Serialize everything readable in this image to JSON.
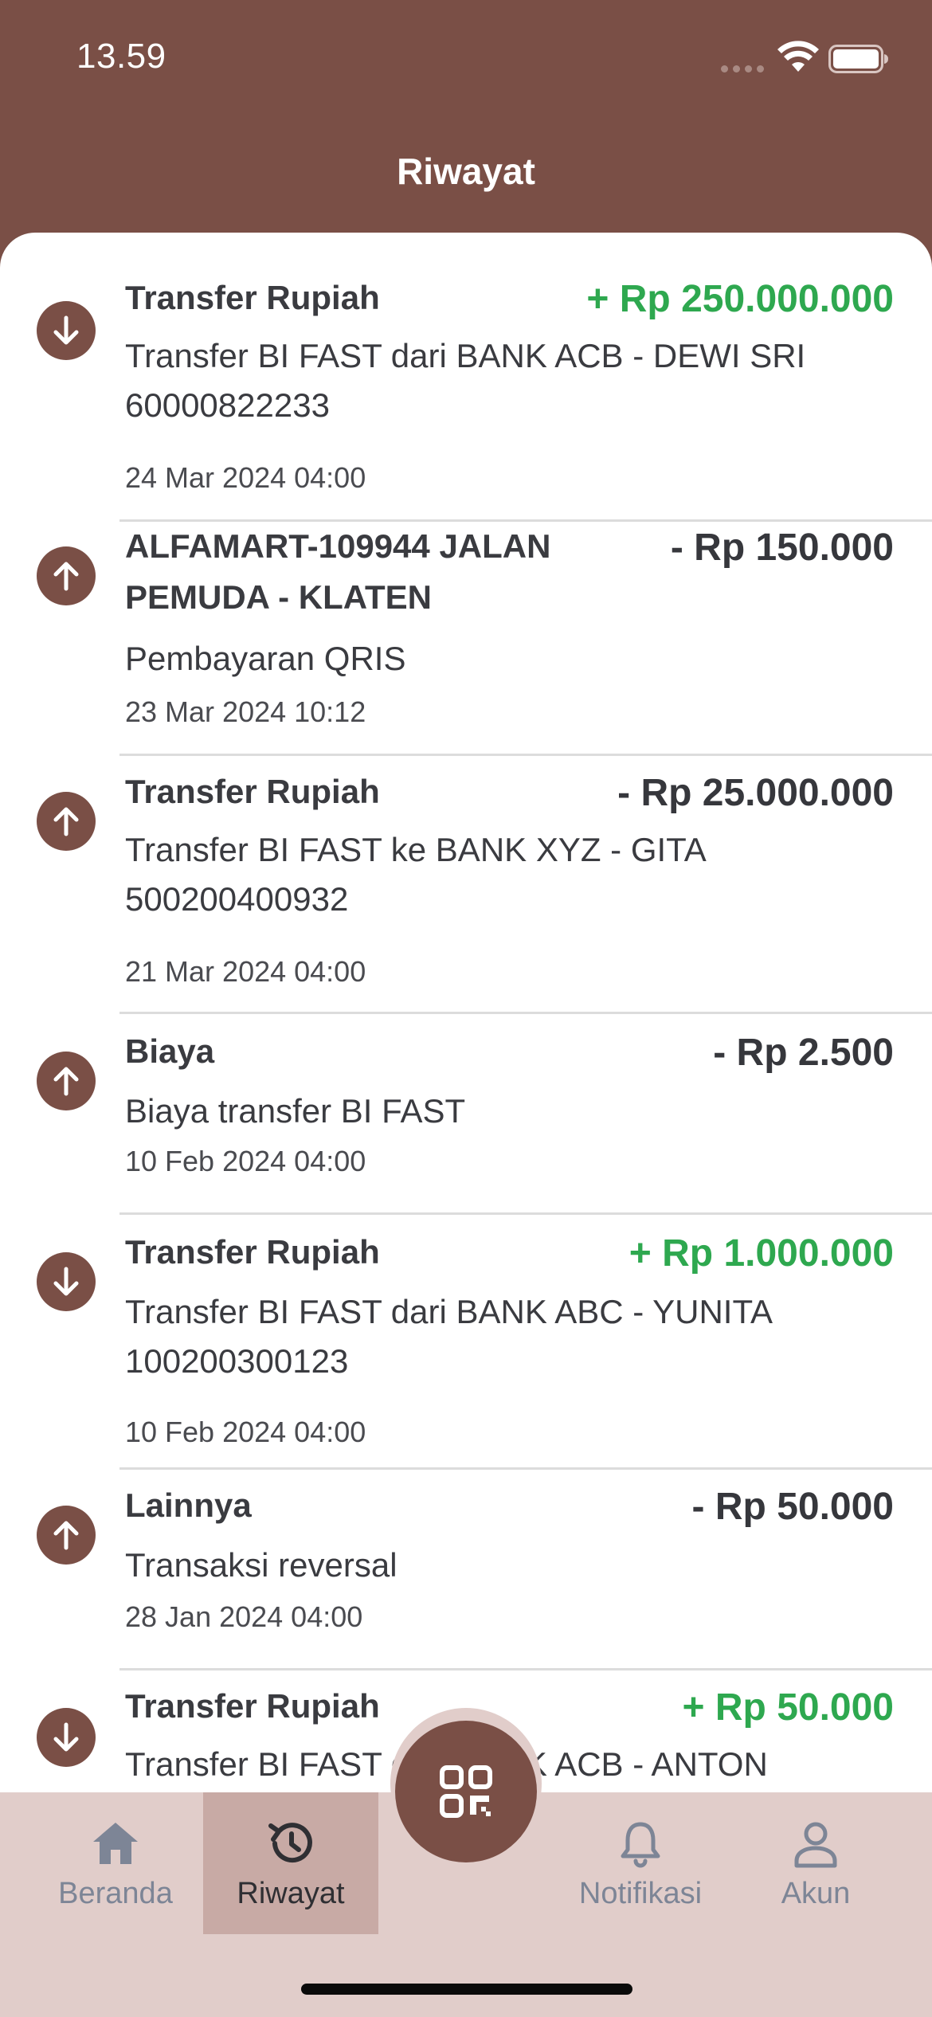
{
  "status_bar": {
    "time": "13.59"
  },
  "header": {
    "title": "Riwayat"
  },
  "transactions": [
    {
      "direction": "in",
      "title": "Transfer Rupiah",
      "amount": "+ Rp 250.000.000",
      "description": "Transfer BI FAST dari BANK ACB - DEWI SRI 60000822233",
      "date": "24 Mar 2024 04:00"
    },
    {
      "direction": "out",
      "title": "ALFAMART-109944 JALAN PEMUDA - KLATEN",
      "amount": "- Rp 150.000",
      "description": "Pembayaran QRIS",
      "date": "23 Mar 2024 10:12"
    },
    {
      "direction": "out",
      "title": "Transfer Rupiah",
      "amount": "- Rp 25.000.000",
      "description": "Transfer BI FAST ke BANK XYZ - GITA 500200400932",
      "date": "21 Mar 2024 04:00"
    },
    {
      "direction": "out",
      "title": "Biaya",
      "amount": "- Rp 2.500",
      "description": "Biaya transfer BI FAST",
      "date": "10 Feb 2024 04:00"
    },
    {
      "direction": "in",
      "title": "Transfer Rupiah",
      "amount": "+ Rp 1.000.000",
      "description": "Transfer BI FAST dari BANK ABC - YUNITA 100200300123",
      "date": "10 Feb 2024 04:00"
    },
    {
      "direction": "out",
      "title": "Lainnya",
      "amount": "- Rp 50.000",
      "description": "Transaksi reversal",
      "date": "28 Jan 2024 04:00"
    },
    {
      "direction": "in",
      "title": "Transfer Rupiah",
      "amount": "+ Rp 50.000",
      "description": "Transfer BI FAST dari BANK ACB - ANTON",
      "date": ""
    }
  ],
  "bottom_nav": {
    "tabs": [
      {
        "label": "Beranda",
        "icon": "home-icon"
      },
      {
        "label": "Riwayat",
        "icon": "history-icon",
        "active": true
      },
      {
        "label": "Notifikasi",
        "icon": "bell-icon"
      },
      {
        "label": "Akun",
        "icon": "user-icon"
      }
    ],
    "center_button": {
      "icon": "qr-scan-icon"
    }
  },
  "colors": {
    "brand": "#7a4f46",
    "nav_background": "#e1cdca",
    "nav_active": "#c8aaa5",
    "incoming_amount": "#2ea84f",
    "outgoing_amount": "#36373c"
  }
}
